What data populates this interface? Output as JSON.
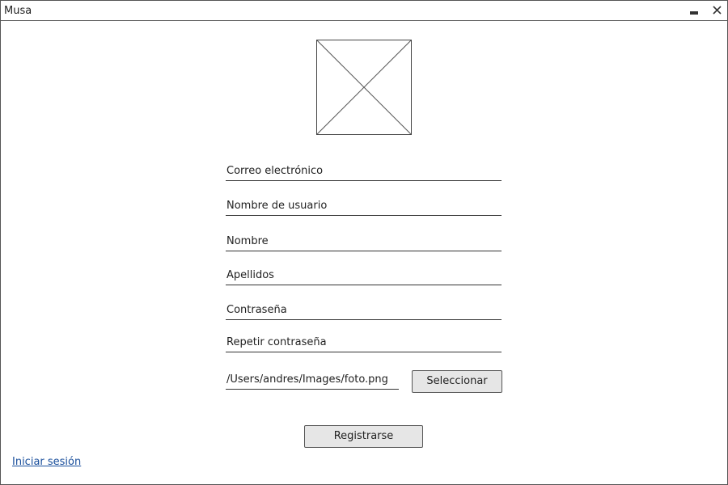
{
  "window": {
    "title": "Musa",
    "controls": {
      "minimize_icon": "minimize-icon",
      "close_icon": "close-icon"
    }
  },
  "logo": {
    "icon": "image-placeholder-icon"
  },
  "form": {
    "email_placeholder": "Correo electrónico",
    "username_placeholder": "Nombre de usuario",
    "name_placeholder": "Nombre",
    "lastname_placeholder": "Apellidos",
    "password_placeholder": "Contraseña",
    "repeat_password_placeholder": "Repetir contraseña",
    "photo_path": "/Users/andres/Images/foto.png",
    "select_label": "Seleccionar",
    "register_label": "Registrarse"
  },
  "footer": {
    "login_link": "Iniciar sesión"
  },
  "colors": {
    "link": "#1a4f9c",
    "button_bg": "#e6e6e6",
    "border": "#555555"
  }
}
